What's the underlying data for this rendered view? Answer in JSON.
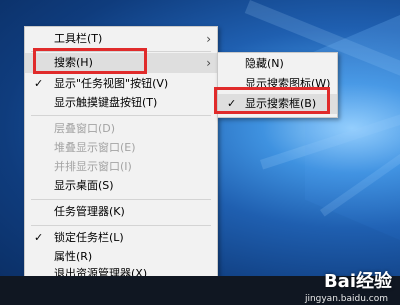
{
  "main_menu": {
    "items": [
      {
        "label": "工具栏(T)",
        "submenu": true
      },
      {
        "label": "搜索(H)",
        "submenu": true,
        "highlighted": true
      },
      {
        "label": "显示\"任务视图\"按钮(V)",
        "checked": true
      },
      {
        "label": "显示触摸键盘按钮(T)"
      },
      {
        "label": "层叠窗口(D)",
        "disabled": true
      },
      {
        "label": "堆叠显示窗口(E)",
        "disabled": true
      },
      {
        "label": "并排显示窗口(I)",
        "disabled": true
      },
      {
        "label": "显示桌面(S)"
      },
      {
        "label": "任务管理器(K)"
      },
      {
        "label": "锁定任务栏(L)",
        "checked": true
      },
      {
        "label": "属性(R)"
      },
      {
        "label": "退出资源管理器(X)"
      }
    ]
  },
  "sub_menu": {
    "items": [
      {
        "label": "隐藏(N)"
      },
      {
        "label": "显示搜索图标(W)"
      },
      {
        "label": "显示搜索框(B)",
        "checked": true,
        "highlighted": true
      }
    ]
  },
  "glyphs": {
    "check": "✓",
    "arrow": "›"
  },
  "colors": {
    "highlight_box": "#e02b2b",
    "menu_bg": "#f2f2f2"
  },
  "watermark": {
    "brand": "Bai经验",
    "url": "jingyan.baidu.com"
  }
}
